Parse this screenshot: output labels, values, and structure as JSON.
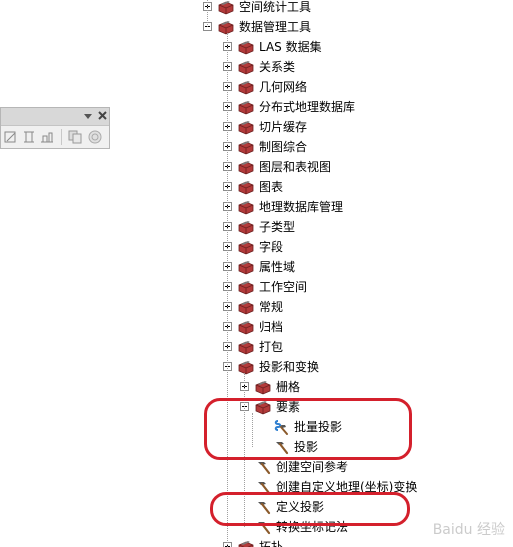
{
  "tree": {
    "root_items": [
      {
        "label": "空间统计工具",
        "expanded": false
      },
      {
        "label": "数据管理工具",
        "expanded": true
      }
    ],
    "data_management_children": [
      "LAS 数据集",
      "关系类",
      "几何网络",
      "分布式地理数据库",
      "切片缓存",
      "制图综合",
      "图层和表视图",
      "图表",
      "地理数据库管理",
      "子类型",
      "字段",
      "属性域",
      "工作空间",
      "常规",
      "归档",
      "打包",
      "投影和变换"
    ],
    "projection_children": [
      {
        "label": "栅格",
        "expanded": false
      },
      {
        "label": "要素",
        "expanded": true
      }
    ],
    "feature_tools": [
      "批量投影",
      "投影"
    ],
    "projection_tools": [
      "创建空间参考",
      "创建自定义地理(坐标)变换",
      "定义投影",
      "转换坐标记法"
    ],
    "partial_bottom": "拓扑"
  },
  "icons": {
    "toolbox": "toolbox-icon",
    "script_tool": "script-tool-icon",
    "tool": "hammer-tool-icon"
  },
  "colors": {
    "toolbox_red": "#b23a3a",
    "annotation_red": "#d4202c"
  },
  "watermark": "Baidu 经验"
}
